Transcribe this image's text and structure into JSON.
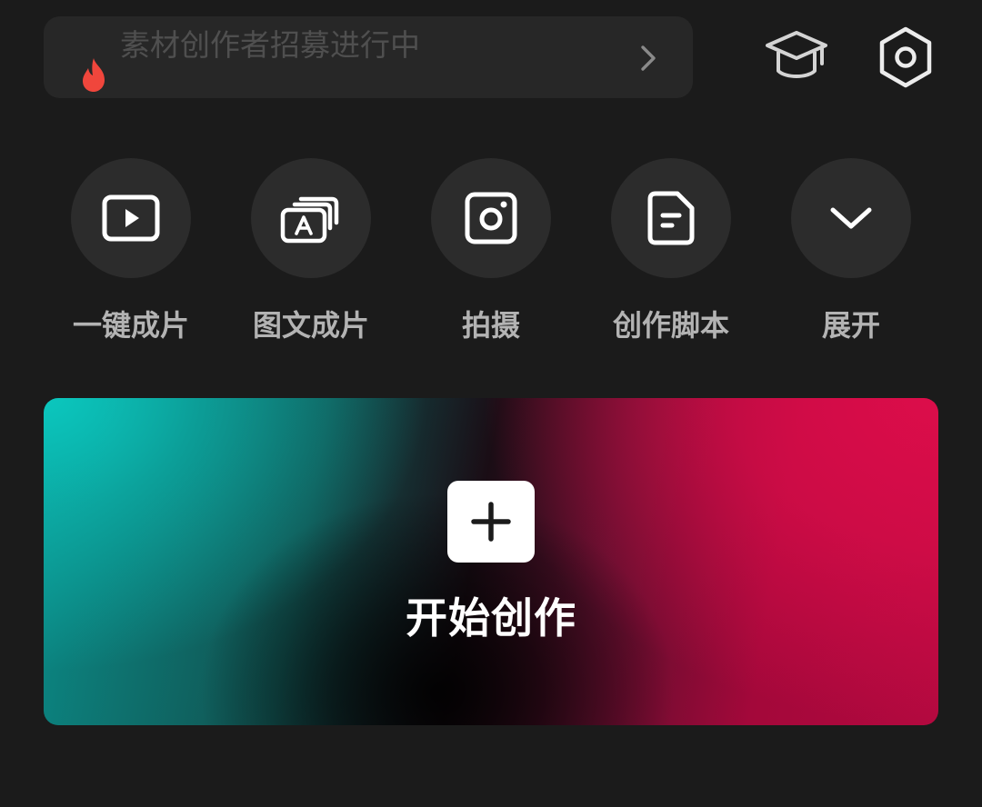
{
  "promo": {
    "text": "素材创作者招募进行中"
  },
  "colors": {
    "background": "#1b1b1b",
    "surface": "#272727",
    "icon_circle": "#2c2c2c",
    "flame": "#f0463c",
    "label": "#b3b3b3",
    "teal": "#0bc7be",
    "crimson": "#dc0d4a"
  },
  "header": {
    "tutorial_icon": "graduation-cap-icon",
    "settings_icon": "hexagon-gear-icon"
  },
  "actions": [
    {
      "icon": "play-window-icon",
      "label": "一键成片"
    },
    {
      "icon": "text-layers-icon",
      "label": "图文成片"
    },
    {
      "icon": "camera-icon",
      "label": "拍摄"
    },
    {
      "icon": "script-document-icon",
      "label": "创作脚本"
    },
    {
      "icon": "chevron-down-icon",
      "label": "展开"
    }
  ],
  "start": {
    "label": "开始创作",
    "icon": "plus-icon"
  }
}
